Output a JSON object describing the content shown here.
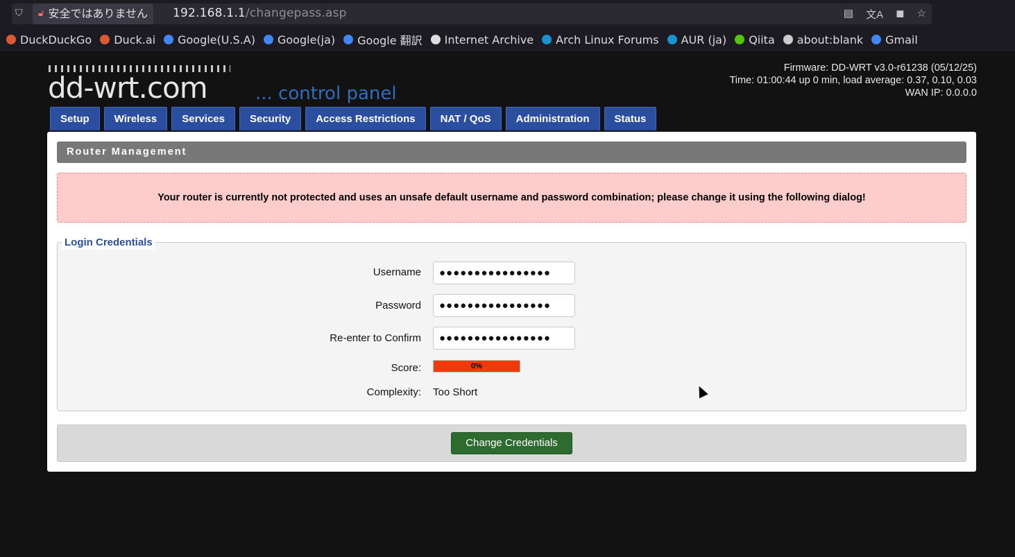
{
  "browser": {
    "security_label": "安全ではありません",
    "url_host": "192.168.1.1",
    "url_path": "/changepass.asp",
    "bookmarks": [
      {
        "label": "DuckDuckGo",
        "icon": "duckduckgo-icon",
        "color": "#de5833"
      },
      {
        "label": "Duck.ai",
        "icon": "duckai-icon",
        "color": "#de5833"
      },
      {
        "label": "Google(U.S.A)",
        "icon": "google-icon",
        "color": "#4285f4"
      },
      {
        "label": "Google(ja)",
        "icon": "google-icon",
        "color": "#4285f4"
      },
      {
        "label": "Google 翻訳",
        "icon": "google-translate-icon",
        "color": "#4285f4"
      },
      {
        "label": "Internet Archive",
        "icon": "archive-icon",
        "color": "#dddddd"
      },
      {
        "label": "Arch Linux Forums",
        "icon": "arch-icon",
        "color": "#1793d1"
      },
      {
        "label": "AUR (ja)",
        "icon": "arch-icon",
        "color": "#1793d1"
      },
      {
        "label": "Qiita",
        "icon": "qiita-icon",
        "color": "#55c500"
      },
      {
        "label": "about:blank",
        "icon": "globe-icon",
        "color": "#cccccc"
      },
      {
        "label": "Gmail",
        "icon": "google-icon",
        "color": "#4285f4"
      }
    ]
  },
  "header": {
    "logo_text": "dd-wrt.com",
    "logo_subtitle": "... control panel",
    "firmware": "Firmware: DD-WRT v3.0-r61238 (05/12/25)",
    "time": "Time: 01:00:44 up 0 min, load average: 0.37, 0.10, 0.03",
    "wan_ip": "WAN IP: 0.0.0.0"
  },
  "tabs": [
    "Setup",
    "Wireless",
    "Services",
    "Security",
    "Access Restrictions",
    "NAT / QoS",
    "Administration",
    "Status"
  ],
  "main": {
    "section_title": "Router Management",
    "warning": "Your router is currently not protected and uses an unsafe default username and password combination; please change it using the following dialog!",
    "legend": "Login Credentials",
    "username_label": "Username",
    "username_value": "●●●●●●●●●●●●●●●●",
    "password_label": "Password",
    "password_value": "●●●●●●●●●●●●●●●●",
    "confirm_label": "Re-enter to Confirm",
    "confirm_value": "●●●●●●●●●●●●●●●●",
    "score_label": "Score:",
    "score_text": "0%",
    "score_fraction": 0,
    "complexity_label": "Complexity:",
    "complexity_value": "Too Short",
    "submit_label": "Change Credentials"
  }
}
